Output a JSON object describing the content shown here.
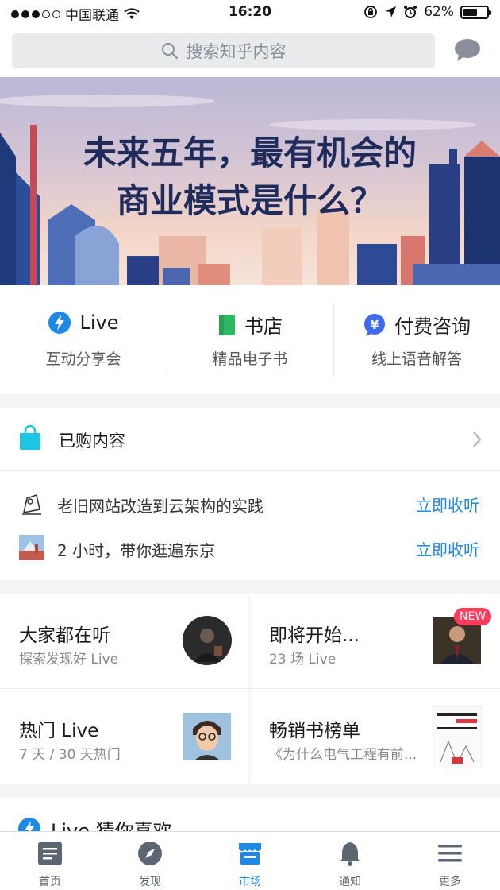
{
  "status": {
    "carrier": "中国联通",
    "time": "16:20",
    "battery": "62%",
    "battery_level": 0.62
  },
  "search": {
    "placeholder": "搜索知乎内容"
  },
  "banner": {
    "line1": "未来五年，最有机会的",
    "line2": "商业模式是什么？"
  },
  "categories": [
    {
      "title": "Live",
      "subtitle": "互动分享会",
      "icon": "lightning-icon",
      "color": "#1e88e5"
    },
    {
      "title": "书店",
      "subtitle": "精品电子书",
      "icon": "book-icon",
      "color": "#2fb863"
    },
    {
      "title": "付费咨询",
      "subtitle": "线上语音解答",
      "icon": "yen-bubble-icon",
      "color": "#3f6bea"
    }
  ],
  "purchased": {
    "label": "已购内容",
    "items": [
      {
        "text": "老旧网站改造到云架构的实践",
        "action": "立即收听"
      },
      {
        "text": "2 小时，带你逛遍东京",
        "action": "立即收听"
      }
    ]
  },
  "cards": [
    {
      "title": "大家都在听",
      "subtitle": "探索发现好 Live"
    },
    {
      "title": "即将开始...",
      "subtitle": "23 场 Live",
      "badge": "NEW"
    },
    {
      "title": "热门 Live",
      "subtitle": "7 天 / 30 天热门"
    },
    {
      "title": "畅销书榜单",
      "subtitle": "《为什么电气工程有前..."
    }
  ],
  "guess": {
    "title": "Live 猜你喜欢"
  },
  "tabs": [
    {
      "label": "首页",
      "icon": "home-icon"
    },
    {
      "label": "发现",
      "icon": "compass-icon"
    },
    {
      "label": "市场",
      "icon": "store-icon",
      "active": true
    },
    {
      "label": "通知",
      "icon": "bell-icon"
    },
    {
      "label": "更多",
      "icon": "menu-icon"
    }
  ],
  "colors": {
    "accent": "#1e88e5",
    "badge": "#ff3b5c",
    "banner_text": "#1f2b5a"
  }
}
